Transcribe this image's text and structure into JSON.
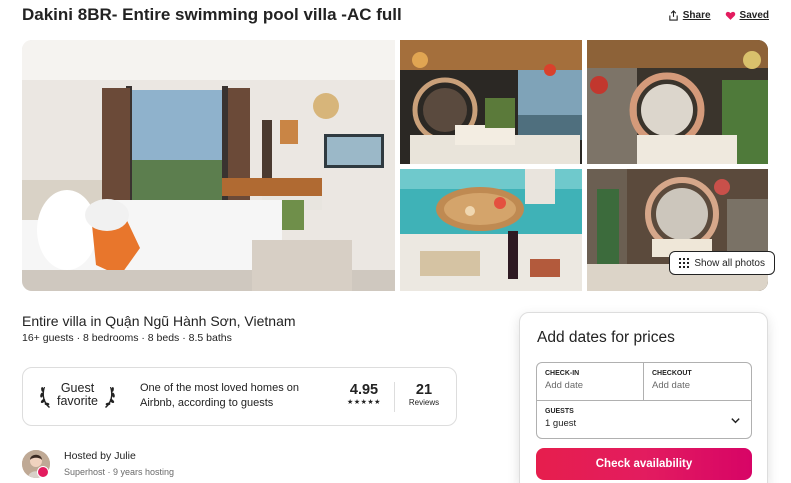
{
  "listing": {
    "title": "Dakini 8BR- Entire swimming pool villa -AC full",
    "share_label": "Share",
    "saved_label": "Saved",
    "show_all_photos_label": "Show all photos",
    "subtitle": "Entire villa in Quận Ngũ Hành Sơn, Vietnam",
    "details": "16+ guests · 8 bedrooms · 8 beds · 8.5 baths"
  },
  "guest_favorite": {
    "badge_line1": "Guest",
    "badge_line2": "favorite",
    "description": "One of the most loved homes on Airbnb, according to guests",
    "rating": "4.95",
    "stars": "★★★★★",
    "review_count": "21",
    "reviews_label": "Reviews"
  },
  "host": {
    "name_line": "Hosted by Julie",
    "meta": "Superhost · 9 years hosting"
  },
  "booking": {
    "title": "Add dates for prices",
    "checkin_label": "CHECK-IN",
    "checkin_placeholder": "Add date",
    "checkout_label": "CHECKOUT",
    "checkout_placeholder": "Add date",
    "guests_label": "GUESTS",
    "guests_value": "1 guest",
    "button_label": "Check availability"
  },
  "colors": {
    "brand": "#e31c5f",
    "text": "#222222",
    "muted": "#6a6a6a",
    "border": "#dddddd"
  },
  "icons": [
    "share-icon",
    "heart-icon",
    "grid-icon",
    "laurel-left-icon",
    "laurel-right-icon",
    "chevron-down-icon"
  ]
}
